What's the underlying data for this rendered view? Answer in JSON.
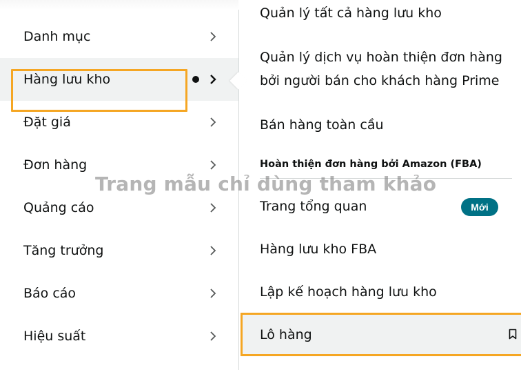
{
  "left_menu": {
    "items": [
      {
        "label": "Danh mục",
        "active": false
      },
      {
        "label": "Hàng lưu kho",
        "active": true
      },
      {
        "label": "Đặt giá",
        "active": false
      },
      {
        "label": "Đơn hàng",
        "active": false
      },
      {
        "label": "Quảng cáo",
        "active": false
      },
      {
        "label": "Tăng trưởng",
        "active": false
      },
      {
        "label": "Báo cáo",
        "active": false
      },
      {
        "label": "Hiệu suất",
        "active": false
      }
    ]
  },
  "submenu": {
    "item_top": "Quản lý tất cả hàng lưu kho",
    "item_fulfillment_line1": "Quản lý dịch vụ hoàn thiện đơn hàng",
    "item_fulfillment_line2": "bởi người bán cho khách hàng Prime",
    "item_global": "Bán hàng toàn cầu",
    "section_heading": "Hoàn thiện đơn hàng bởi Amazon (FBA)",
    "item_overview": "Trang tổng quan",
    "badge_new": "Mới",
    "item_fba_inventory": "Hàng lưu kho FBA",
    "item_planning": "Lập kế hoạch hàng lưu kho",
    "item_shipments": "Lô hàng"
  },
  "watermark": "Trang mẫu chỉ dùng tham khảo",
  "colors": {
    "highlight": "#f5a623",
    "badge": "#007185",
    "active_bg": "#f0f2f2"
  }
}
